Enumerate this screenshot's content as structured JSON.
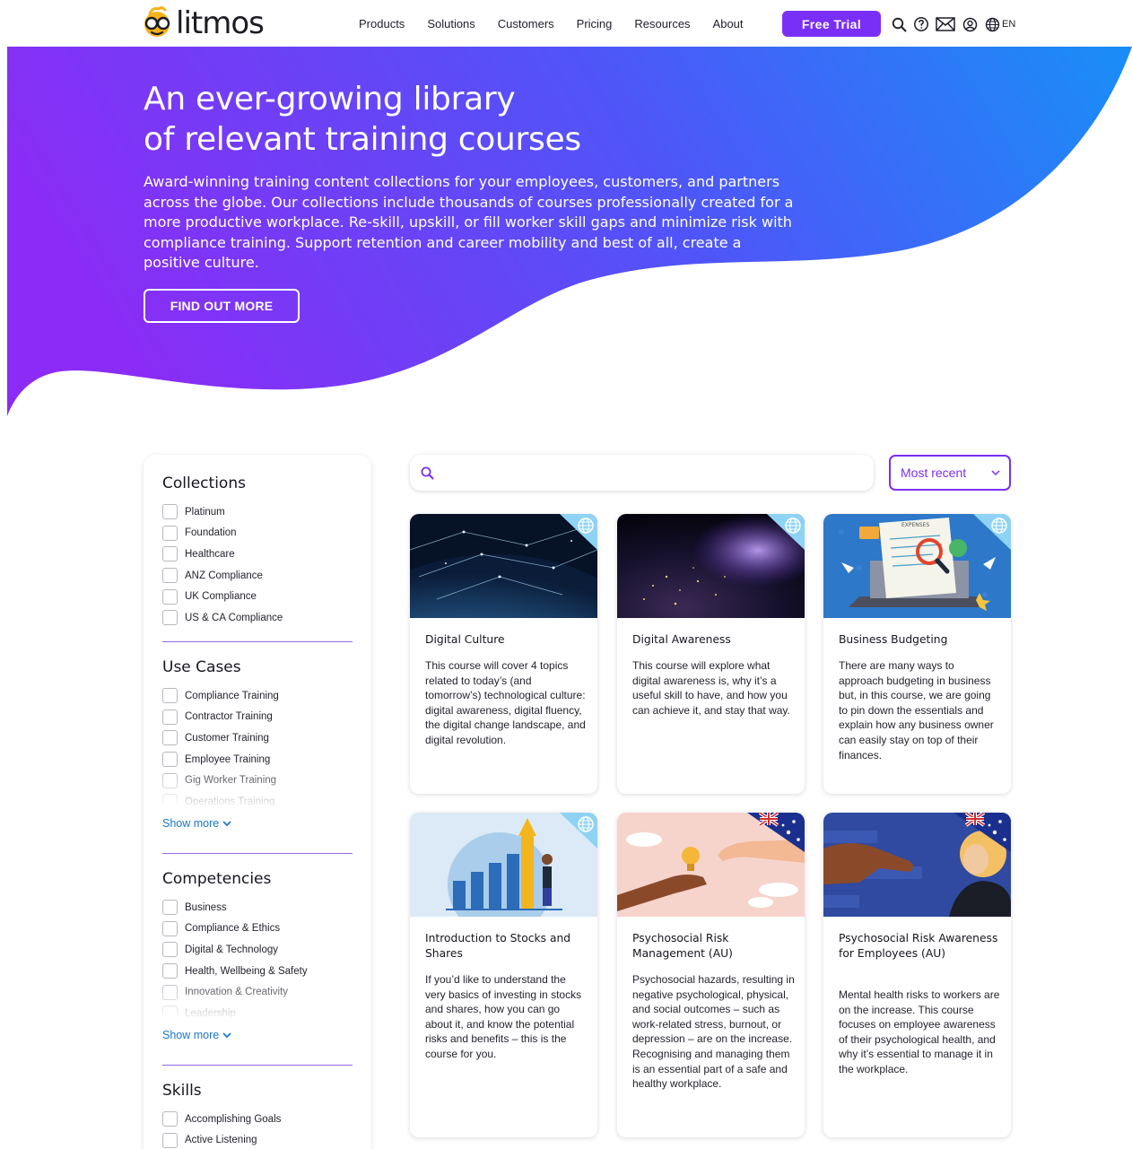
{
  "nav": {
    "logo_text": "litmos",
    "links": [
      "Products",
      "Solutions",
      "Customers",
      "Pricing",
      "Resources",
      "About"
    ],
    "cta": "Free Trial",
    "language": "EN",
    "icons": [
      "search-icon",
      "support-icon",
      "mail-icon",
      "user-icon",
      "globe-icon"
    ]
  },
  "hero": {
    "title_line1": "An ever-growing library",
    "title_line2": "of relevant training courses",
    "text": "Award-winning training content collections for your employees, customers, and partners across the globe. Our collections include thousands of courses professionally created for a more productive workplace. Re-skill, upskill, or fill worker skill gaps and minimize risk with compliance training. Support retention and career mobility and best of all, create a positive culture.",
    "button": "FIND OUT MORE",
    "gradient": [
      "#8a2cf5",
      "#4f55f8",
      "#1b8cf7"
    ]
  },
  "filters": {
    "collections": {
      "title": "Collections",
      "items": [
        "Platinum",
        "Foundation",
        "Healthcare",
        "ANZ Compliance",
        "UK Compliance",
        "US & CA Compliance"
      ]
    },
    "use_cases": {
      "title": "Use Cases",
      "items": [
        "Compliance Training",
        "Contractor Training",
        "Customer Training",
        "Employee Training",
        "Gig Worker Training",
        "Operations Training"
      ],
      "show_more": "Show more"
    },
    "competencies": {
      "title": "Competencies",
      "items": [
        "Business",
        "Compliance & Ethics",
        "Digital & Technology",
        "Health, Wellbeing & Safety",
        "Innovation & Creativity",
        "Leadership"
      ],
      "show_more": "Show more"
    },
    "skills": {
      "title": "Skills",
      "items": [
        "Accomplishing Goals",
        "Active Listening"
      ]
    }
  },
  "search": {
    "placeholder": ""
  },
  "sort": {
    "selected": "Most recent"
  },
  "accent_color": "#7a2ff7",
  "link_color": "#1a77c9",
  "courses": [
    {
      "title": "Digital Culture",
      "description": "This course will cover 4 topics related to today’s (and tomorrow’s) technological culture: digital awareness, digital fluency, the digital change landscape, and digital revolution.",
      "badge": "globe-icon"
    },
    {
      "title": "Digital Awareness",
      "description": "This course will explore what digital awareness is, why it’s a useful skill to have, and how you can achieve it, and stay that way.",
      "badge": "globe-icon"
    },
    {
      "title": "Business Budgeting",
      "description": "There are many ways to approach budgeting in business but, in this course, we are going to pin down the essentials and explain how any business owner can easily stay on top of their finances.",
      "badge": "globe-icon",
      "image_text": "EXPENSES"
    },
    {
      "title": "Introduction to Stocks and Shares",
      "description": "If you’d like to understand the very basics of investing in stocks and shares, how you can go about it, and know the potential risks and benefits – this is the course for you.",
      "badge": "globe-icon"
    },
    {
      "title": "Psychosocial Risk Management (AU)",
      "description": "Psychosocial hazards, resulting in negative psychological, physical, and social outcomes – such as work-related stress, burnout, or depression – are on the increase. Recognising and managing them is an essential part of a safe and healthy workplace.",
      "badge": "australia-flag-icon"
    },
    {
      "title": "Psychosocial Risk Awareness for Employees (AU)",
      "description": "Mental health risks to workers are on the increase. This course focuses on employee awareness of their psychological health, and why it’s essential to manage it in the workplace.",
      "badge": "australia-flag-icon"
    }
  ]
}
